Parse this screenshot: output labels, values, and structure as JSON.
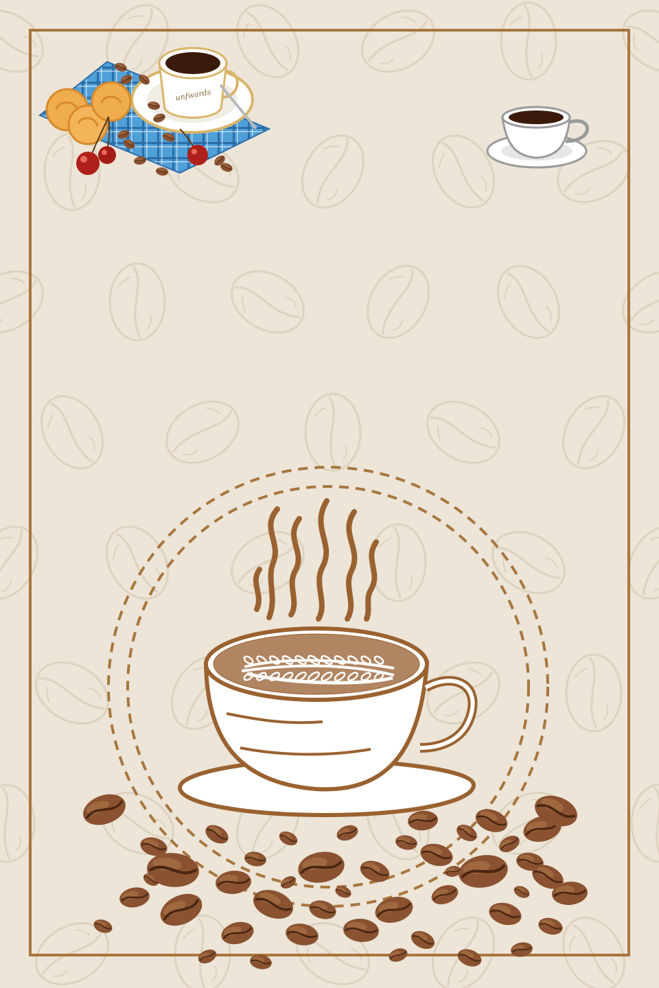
{
  "poster": {
    "background_color": "#ECE5D8",
    "pattern_color": "#D9CCB6",
    "frame_color": "#A8763E",
    "sketch_color": "#9A6230",
    "bean_color": "#8A5230"
  },
  "cup_inscription": "unfwards",
  "icons": {
    "pattern": "coffee-bean-pattern",
    "frame": "rectangular-frame",
    "breakfast": "coffee-breakfast-illustration",
    "small_cup": "espresso-cup-icon",
    "steam": "steam-icon",
    "cup": "latte-cup-icon",
    "beans": "scattered-coffee-beans"
  }
}
